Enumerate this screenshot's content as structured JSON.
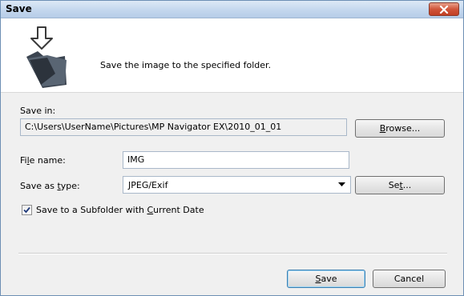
{
  "window": {
    "title": "Save"
  },
  "header": {
    "description": "Save the image to the specified folder."
  },
  "save_in": {
    "label": "Save in:",
    "path": "C:\\Users\\UserName\\Pictures\\MP Navigator EX\\2010_01_01",
    "browse_label_pre": "",
    "browse_label_mnemonic": "B",
    "browse_label_post": "rowse..."
  },
  "file_name": {
    "label_pre": "Fi",
    "label_mnemonic": "l",
    "label_post": "e name:",
    "value": "IMG"
  },
  "save_as_type": {
    "label_pre": "Save as ",
    "label_mnemonic": "t",
    "label_post": "ype:",
    "selected": "JPEG/Exif",
    "set_label_pre": "Se",
    "set_label_mnemonic": "t",
    "set_label_post": "..."
  },
  "subfolder_option": {
    "checked": true,
    "label_pre": "Save to a Subfolder with ",
    "label_mnemonic": "C",
    "label_post": "urrent Date"
  },
  "buttons": {
    "save_mnemonic": "S",
    "save_post": "ave",
    "cancel": "Cancel"
  },
  "icons": {
    "close": "close-icon",
    "header": "save-folder-icon",
    "dropdown": "chevron-down-icon",
    "check": "checkmark-icon"
  }
}
